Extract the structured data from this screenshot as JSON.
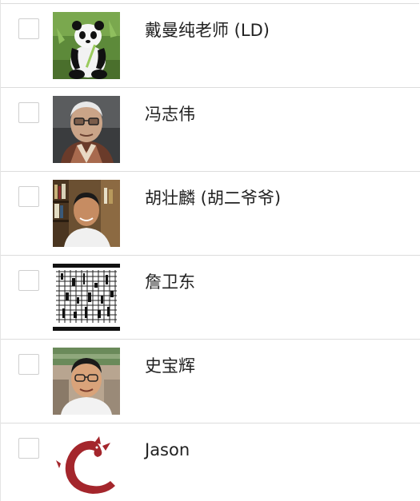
{
  "contacts": [
    {
      "name": "戴曼纯老师 (LD)",
      "checked": false,
      "avatar": "panda-photo"
    },
    {
      "name": "冯志伟",
      "checked": false,
      "avatar": "elderly-man-glasses-photo"
    },
    {
      "name": "胡壮麟 (胡二爷爷)",
      "checked": false,
      "avatar": "man-bookshelf-photo"
    },
    {
      "name": "詹卫东",
      "checked": false,
      "avatar": "abstract-pattern-image"
    },
    {
      "name": "史宝辉",
      "checked": false,
      "avatar": "man-glasses-outdoor-photo"
    },
    {
      "name": "Jason",
      "checked": false,
      "avatar": "red-dragon-logo"
    }
  ],
  "colors": {
    "divider": "#dcdcdc",
    "checkbox_border": "#cfcfcf",
    "text": "#222222",
    "dragon_red": "#a4262c"
  }
}
